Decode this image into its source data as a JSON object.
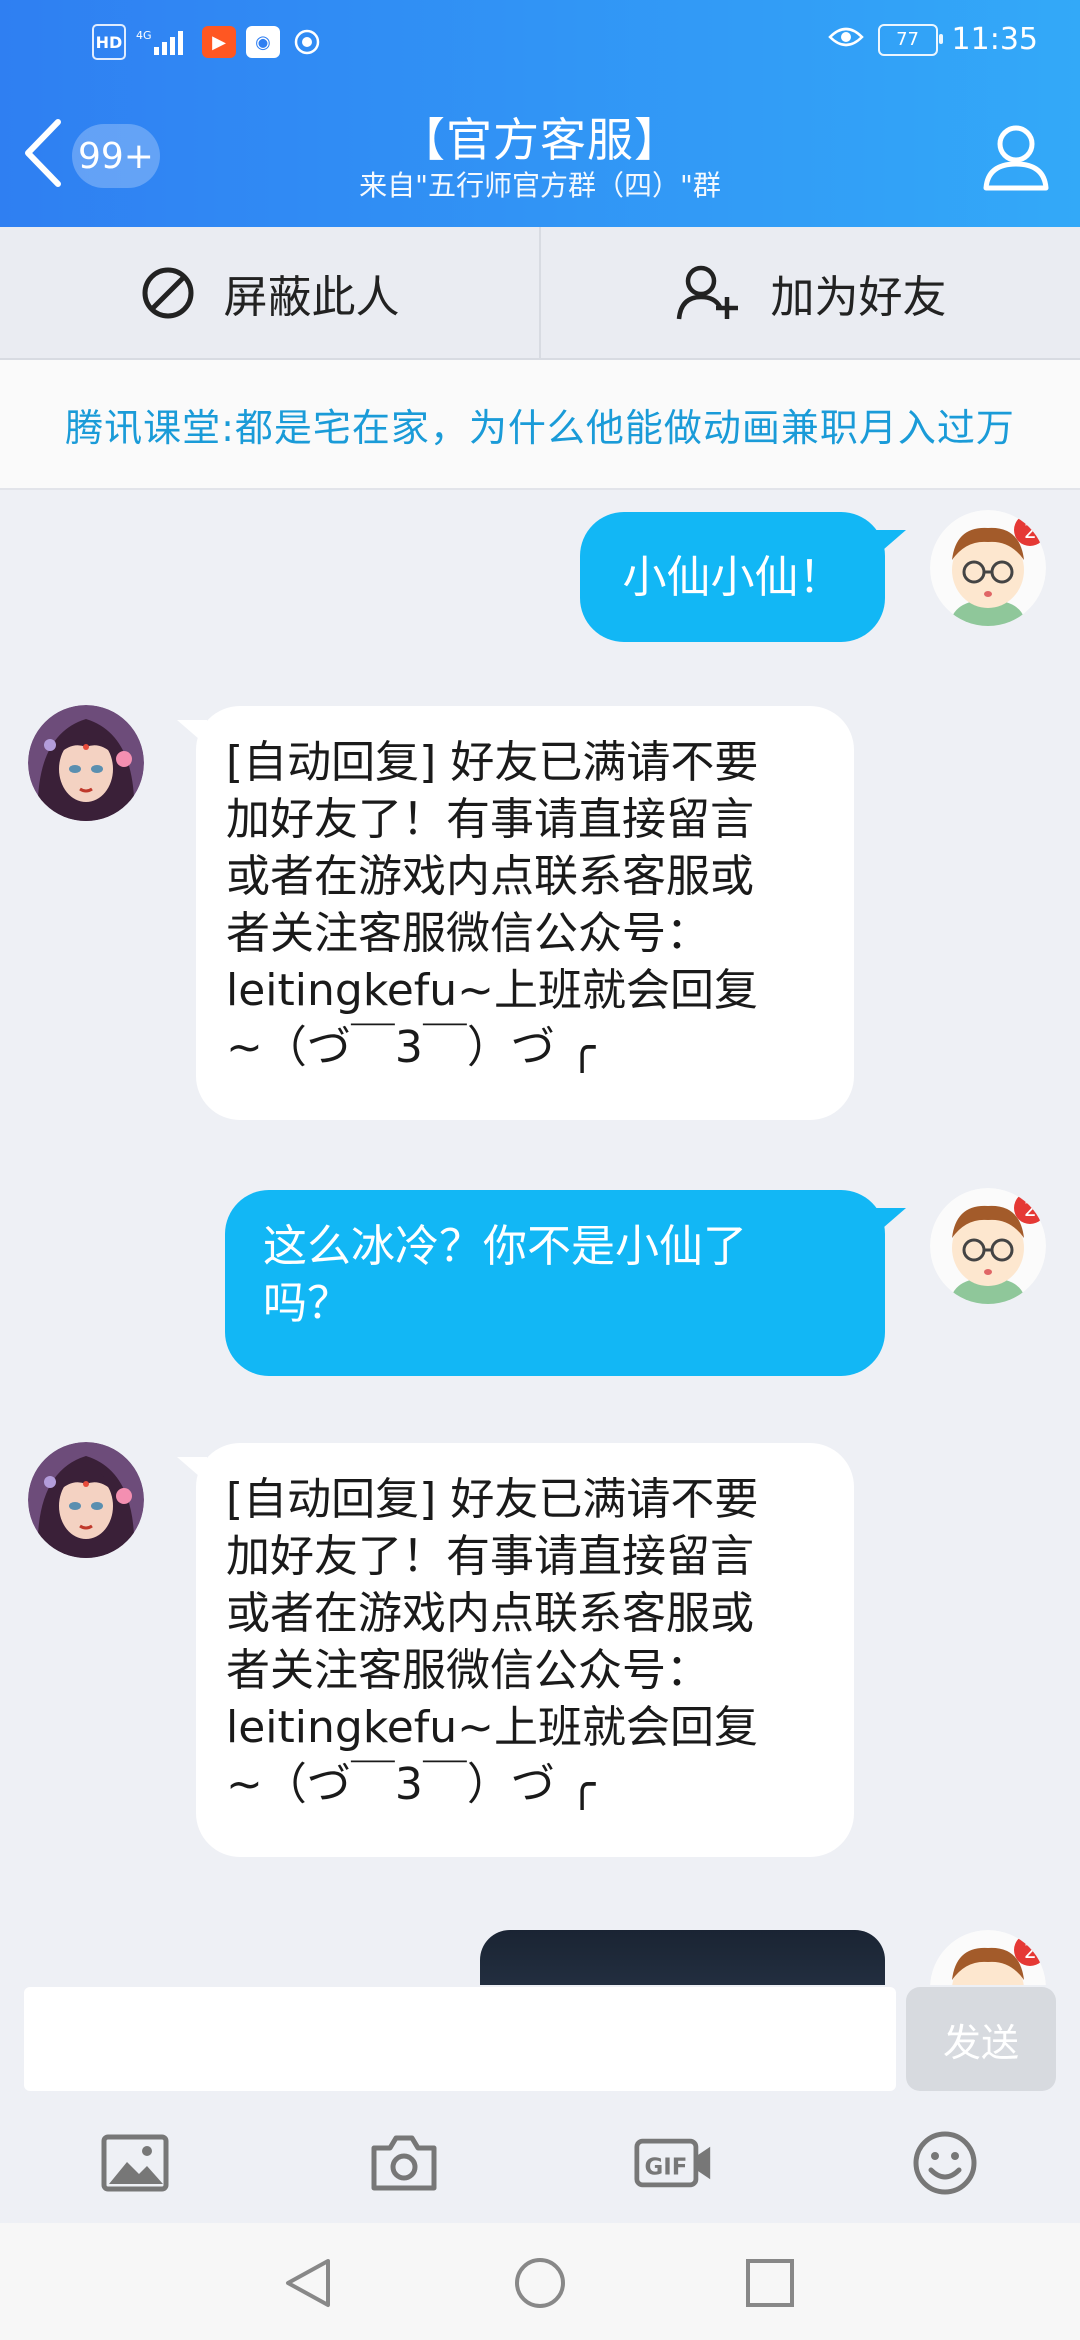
{
  "status_bar": {
    "hd": "HD",
    "network": "4G",
    "battery": "77",
    "time": "11:35"
  },
  "header": {
    "unread_badge": "99+",
    "title": "【官方客服】",
    "subtitle": "来自\"五行师官方群（四）\"群"
  },
  "actions": {
    "block_label": "屏蔽此人",
    "add_friend_label": "加为好友"
  },
  "banner": {
    "text": "腾讯课堂:都是宅在家，为什么他能做动画兼职月入过万"
  },
  "messages": [
    {
      "side": "out",
      "text": "小仙小仙！"
    },
    {
      "side": "in",
      "lines": [
        "[自动回复] 好友已满请不要",
        "加好友了！有事请直接留言",
        "或者在游戏内点联系客服或",
        "者关注客服微信公众号：",
        "leitingkefu~上班就会回复",
        "~（づ￣3￣）づ ╭"
      ]
    },
    {
      "side": "out",
      "lines": [
        "这么冰冷？你不是小仙了",
        "吗？"
      ]
    },
    {
      "side": "in",
      "lines": [
        "[自动回复] 好友已满请不要",
        "加好友了！有事请直接留言",
        "或者在游戏内点联系客服或",
        "者关注客服微信公众号：",
        "leitingkefu~上班就会回复",
        "~（づ￣3￣）づ ╭"
      ]
    }
  ],
  "input": {
    "placeholder": "",
    "send_label": "发送"
  },
  "toolbar": {
    "icons": [
      "image-icon",
      "camera-icon",
      "gif-icon",
      "emoji-icon"
    ]
  },
  "colors": {
    "header_start": "#2f7ff2",
    "header_end": "#33a9f8",
    "outgoing_bubble": "#12b7f5",
    "banner_text": "#1a9bd8"
  }
}
